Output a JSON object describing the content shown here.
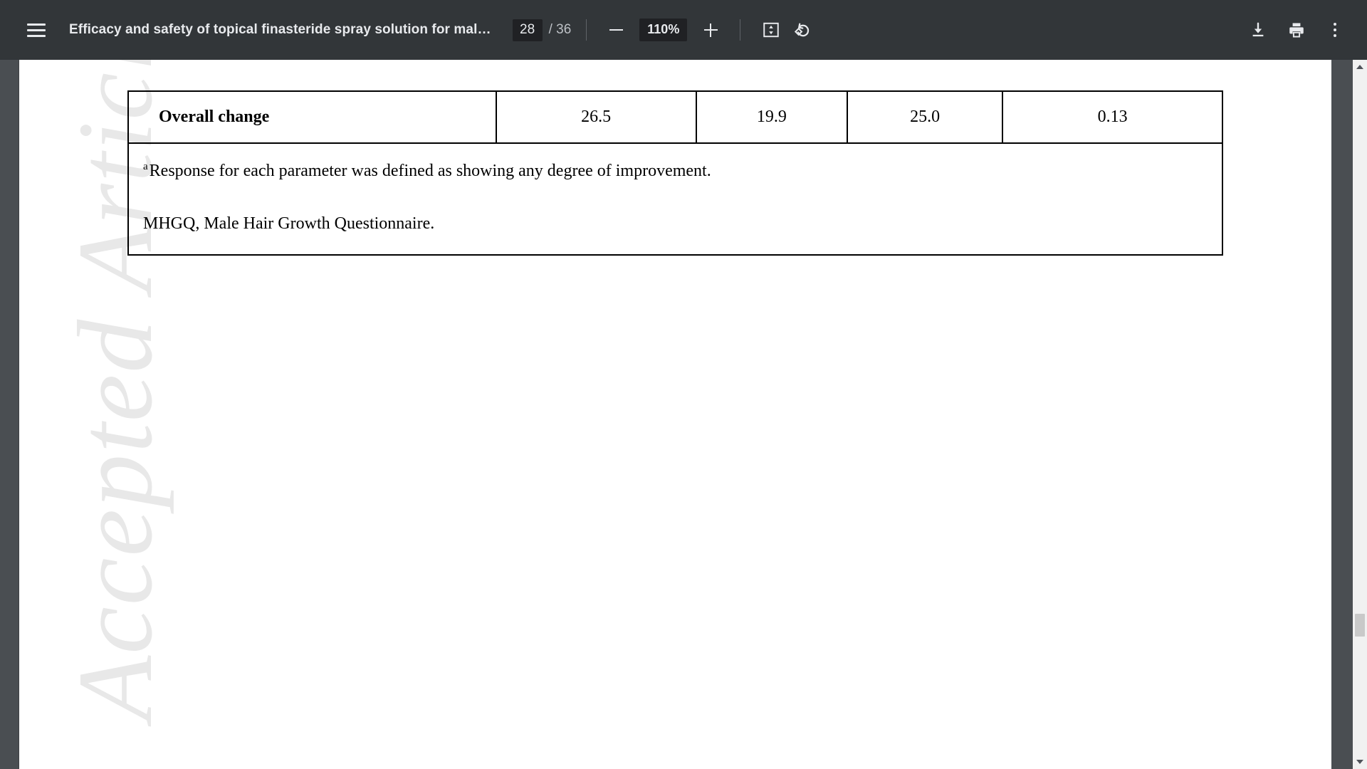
{
  "toolbar": {
    "menu_icon": "hamburger-menu-icon",
    "document_title": "Efficacy and safety of topical finasteride spray solution for mal…",
    "page_current": "28",
    "page_total": "/ 36",
    "zoom_out_icon": "minus-icon",
    "zoom_level": "110%",
    "zoom_in_icon": "plus-icon",
    "fit_icon": "fit-to-page-icon",
    "rotate_icon": "rotate-counterclockwise-icon",
    "download_icon": "download-icon",
    "print_icon": "print-icon",
    "more_icon": "more-vertical-icon",
    "colors": {
      "toolbar_bg": "#323639",
      "field_bg": "#202124",
      "icon": "#e8eaed",
      "viewer_bg": "#4a4e52",
      "page_bg": "#ffffff"
    }
  },
  "document": {
    "watermark": "Accepted Article",
    "table": {
      "row": {
        "label": "Overall change",
        "values": [
          "26.5",
          "19.9",
          "25.0",
          "0.13"
        ]
      },
      "footnotes": [
        {
          "marker": "a",
          "text": "Response for each parameter was defined as showing any degree of improvement."
        },
        {
          "marker": "",
          "text": "MHGQ, Male Hair Growth Questionnaire."
        }
      ]
    }
  },
  "scrollbar": {
    "up_icon": "scroll-up-arrow-icon",
    "down_icon": "scroll-down-arrow-icon",
    "thumb": "scrollbar-thumb"
  }
}
